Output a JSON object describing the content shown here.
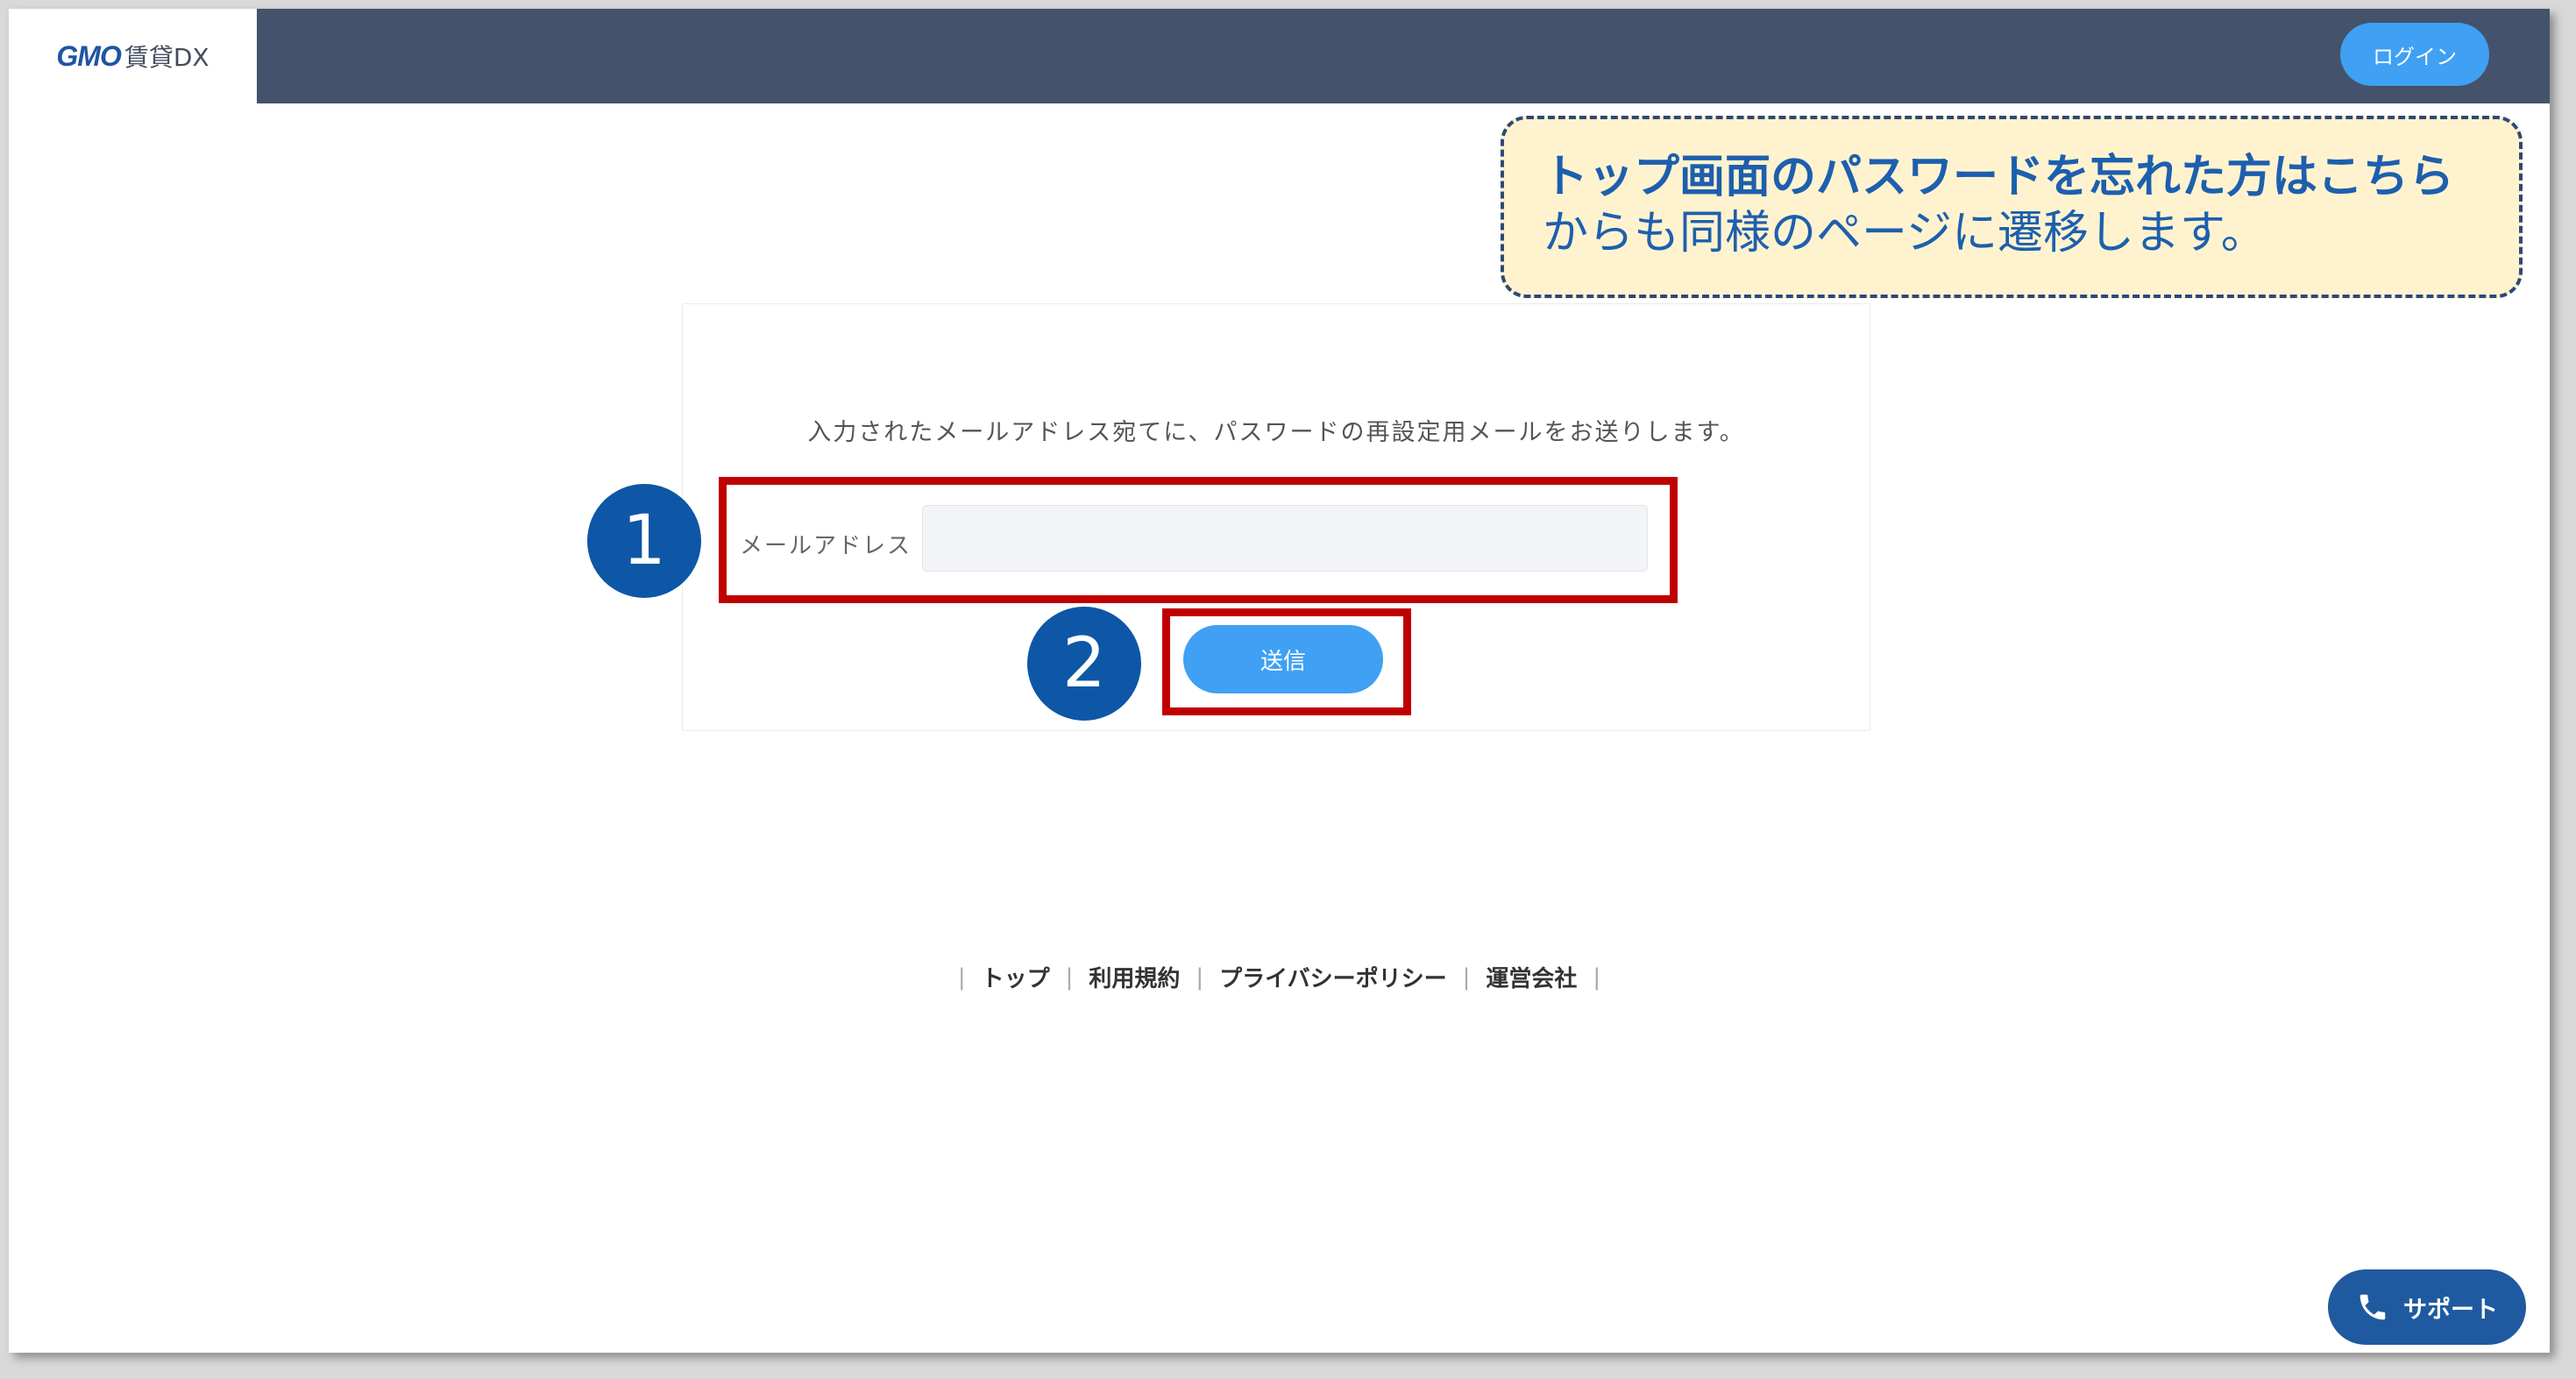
{
  "header": {
    "logo_main": "GMO",
    "logo_sub": "賃貸DX",
    "login_label": "ログイン"
  },
  "callout": {
    "line1": "トップ画面のパスワードを忘れた方はこちら",
    "line2": "からも同様のページに遷移します。"
  },
  "form": {
    "instruction": "入力されたメールアドレス宛てに、パスワードの再設定用メールをお送りします。",
    "email_label": "メールアドレス",
    "email_value": "",
    "email_placeholder": "",
    "submit_label": "送信"
  },
  "steps": {
    "one": "1",
    "two": "2"
  },
  "footer": {
    "links": [
      "トップ",
      "利用規約",
      "プライバシーポリシー",
      "運営会社"
    ]
  },
  "support": {
    "label": "サポート"
  },
  "colors": {
    "header_bg": "#45526b",
    "accent_button": "#3fa0f4",
    "support_button": "#1f5aa0",
    "highlight_red": "#c00000",
    "step_circle": "#0d57a6",
    "callout_bg": "#fff3cf",
    "callout_text": "#1d5fae"
  },
  "icons": {
    "support": "phone-icon"
  }
}
